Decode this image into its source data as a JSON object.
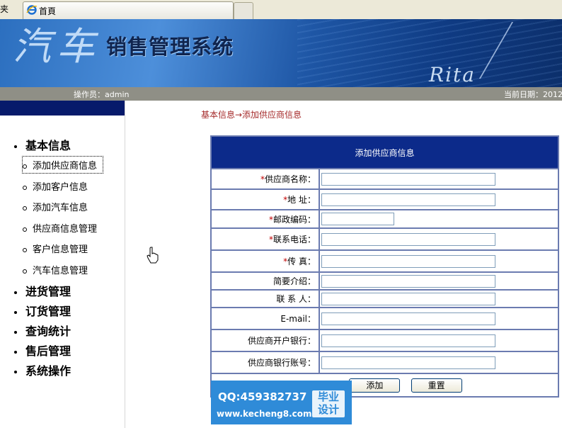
{
  "browser": {
    "left_label": "夹",
    "tab_title": "首頁"
  },
  "banner": {
    "brush_text": "汽车",
    "title": "销售管理系统",
    "signature": "Rita"
  },
  "operator_bar": {
    "operator": "操作员：admin",
    "date": "当前日期：2012"
  },
  "nav": {
    "sections": [
      {
        "label": "基本信息"
      },
      {
        "label": "进货管理"
      },
      {
        "label": "订货管理"
      },
      {
        "label": "查询统计"
      },
      {
        "label": "售后管理"
      },
      {
        "label": "系统操作"
      }
    ],
    "subitems": [
      {
        "label": "添加供应商信息"
      },
      {
        "label": "添加客户信息"
      },
      {
        "label": "添加汽车信息"
      },
      {
        "label": "供应商信息管理"
      },
      {
        "label": "客户信息管理"
      },
      {
        "label": "汽车信息管理"
      }
    ]
  },
  "main": {
    "breadcrumb": "基本信息→添加供应商信息",
    "form_title": "添加供应商信息",
    "required_mark": "*",
    "fields": [
      {
        "label": "供应商名称：",
        "required": true,
        "value": ""
      },
      {
        "label": "地  址：",
        "required": true,
        "value": ""
      },
      {
        "label": "邮政编码：",
        "required": true,
        "value": ""
      },
      {
        "label": "联系电话：",
        "required": true,
        "value": ""
      },
      {
        "label": "传  真：",
        "required": true,
        "value": ""
      },
      {
        "label": "简要介绍：",
        "required": false,
        "value": ""
      },
      {
        "label": "联 系 人：",
        "required": false,
        "value": ""
      },
      {
        "label": "E-mail：",
        "required": false,
        "value": ""
      },
      {
        "label": "供应商开户银行：",
        "required": false,
        "value": ""
      },
      {
        "label": "供应商银行账号：",
        "required": false,
        "value": ""
      }
    ],
    "submit_label": "添加",
    "reset_label": "重置"
  },
  "watermark": {
    "qq": "QQ:459382737",
    "url": "www.kecheng8.com",
    "tag_line1": "毕业",
    "tag_line2": "设计"
  },
  "colors": {
    "nav_top": "#071a6b",
    "form_header": "#0c2a8a",
    "breadcrumb": "#a52a2a",
    "required": "#c00000",
    "operator_bar": "#8f8f86"
  }
}
